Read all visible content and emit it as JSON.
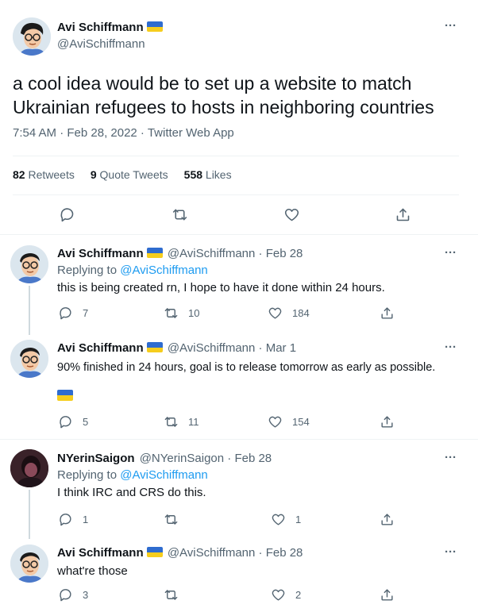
{
  "main_tweet": {
    "author_name": "Avi Schiffmann",
    "handle": "@AviSchiffmann",
    "text_line1": "a cool idea would be to set up a website to match",
    "text_line2": "Ukrainian refugees to hosts in neighboring countries",
    "meta": "7:54 AM · Feb 28, 2022 · Twitter Web App",
    "stats": {
      "retweets_count": "82",
      "retweets_label": "Retweets",
      "quotes_count": "9",
      "quotes_label": "Quote Tweets",
      "likes_count": "558",
      "likes_label": "Likes"
    }
  },
  "replies": [
    {
      "author_name": "Avi Schiffmann",
      "handle_date": "@AviSchiffmann · Feb 28",
      "replying_prefix": "Replying to ",
      "replying_to": "@AviSchiffmann",
      "text": "this is being created rn, I hope to have it done within 24 hours.",
      "reply_count": "7",
      "retweet_count": "10",
      "like_count": "184"
    },
    {
      "author_name": "Avi Schiffmann",
      "handle_date": "@AviSchiffmann · Mar 1",
      "text": "90% finished in 24 hours, goal is to release tomorrow as early as possible.",
      "reply_count": "5",
      "retweet_count": "11",
      "like_count": "154"
    },
    {
      "author_name": "NYerinSaigon",
      "handle_date": "@NYerinSaigon · Feb 28",
      "replying_prefix": "Replying to ",
      "replying_to": "@AviSchiffmann",
      "text": "I think IRC and CRS do this.",
      "reply_count": "1",
      "retweet_count": "",
      "like_count": "1"
    },
    {
      "author_name": "Avi Schiffmann",
      "handle_date": "@AviSchiffmann · Feb 28",
      "text": "what're those",
      "reply_count": "3",
      "retweet_count": "",
      "like_count": "2"
    }
  ],
  "more_glyph": "···",
  "colors": {
    "link": "#1d9bf0",
    "muted": "#536471",
    "flag_blue": "#2f6ccf",
    "flag_yellow": "#f6cd1d"
  },
  "icons": [
    "reply-icon",
    "retweet-icon",
    "like-icon",
    "share-icon",
    "more-icon",
    "ukraine-flag-icon"
  ]
}
